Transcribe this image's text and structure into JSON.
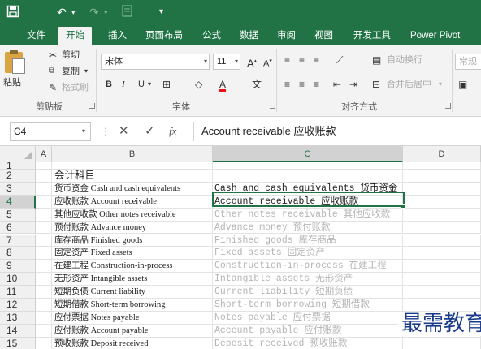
{
  "quick_access": {
    "save_icon": "save-icon",
    "undo_icon": "undo-icon",
    "redo_icon": "redo-icon",
    "preview_icon": "print-preview-icon",
    "customize_icon": "customize-icon"
  },
  "tabs": [
    {
      "label": "文件"
    },
    {
      "label": "开始",
      "active": true
    },
    {
      "label": "插入"
    },
    {
      "label": "页面布局"
    },
    {
      "label": "公式"
    },
    {
      "label": "数据"
    },
    {
      "label": "审阅"
    },
    {
      "label": "视图"
    },
    {
      "label": "开发工具"
    },
    {
      "label": "Power Pivot"
    }
  ],
  "ribbon": {
    "clipboard": {
      "paste": "粘贴",
      "cut": "剪切",
      "copy": "复制",
      "format_painter": "格式刷",
      "group_label": "剪贴板"
    },
    "font": {
      "font_name": "宋体",
      "font_size": "11",
      "bold": "B",
      "italic": "I",
      "underline": "U",
      "grow": "A",
      "shrink": "A",
      "group_label": "字体"
    },
    "alignment": {
      "wrap_text": "自动换行",
      "merge_center": "合并后居中",
      "group_label": "对齐方式"
    },
    "number": {
      "format": "常规"
    }
  },
  "formula_bar": {
    "name_box": "C4",
    "cancel": "✕",
    "enter": "✓",
    "fx": "fx",
    "content": "Account receivable 应收账款"
  },
  "columns": [
    "A",
    "B",
    "C",
    "D"
  ],
  "selected_column": "C",
  "selected_row": "4",
  "rows": [
    {
      "num": "1",
      "b": "",
      "c": ""
    },
    {
      "num": "2",
      "b": "会计科目",
      "c": ""
    },
    {
      "num": "3",
      "b": "货币资金 Cash and cash equivalents",
      "c": "Cash and cash equivalents 货币资金"
    },
    {
      "num": "4",
      "b": "应收账款 Account receivable",
      "c": "Account receivable 应收账款"
    },
    {
      "num": "5",
      "b": "其他应收款 Other notes receivable",
      "c": "Other notes receivable 其他应收款"
    },
    {
      "num": "6",
      "b": "预付账款 Advance money",
      "c": "Advance money 预付账款"
    },
    {
      "num": "7",
      "b": "库存商品 Finished goods",
      "c": "Finished goods 库存商品"
    },
    {
      "num": "8",
      "b": "固定资产 Fixed assets",
      "c": "Fixed assets 固定资产"
    },
    {
      "num": "9",
      "b": "在建工程 Construction-in-process",
      "c": "Construction-in-process 在建工程"
    },
    {
      "num": "10",
      "b": "无形资产 Intangible assets",
      "c": "Intangible assets 无形资产"
    },
    {
      "num": "11",
      "b": "短期负债 Current liability",
      "c": "Current liability 短期负债"
    },
    {
      "num": "12",
      "b": "短期借款 Short-term borrowing",
      "c": "Short-term borrowing 短期借款"
    },
    {
      "num": "13",
      "b": "应付票据 Notes payable",
      "c": "Notes payable 应付票据"
    },
    {
      "num": "14",
      "b": "应付账款 Account payable",
      "c": "Account payable 应付账款"
    },
    {
      "num": "15",
      "b": "预收账款 Deposit received",
      "c": "Deposit received 预收账款"
    }
  ],
  "watermark": "最需教育",
  "colors": {
    "excel_green": "#217346",
    "ribbon_bg": "#f3f3f3",
    "flash_fill_gray": "#b5b5b5"
  }
}
